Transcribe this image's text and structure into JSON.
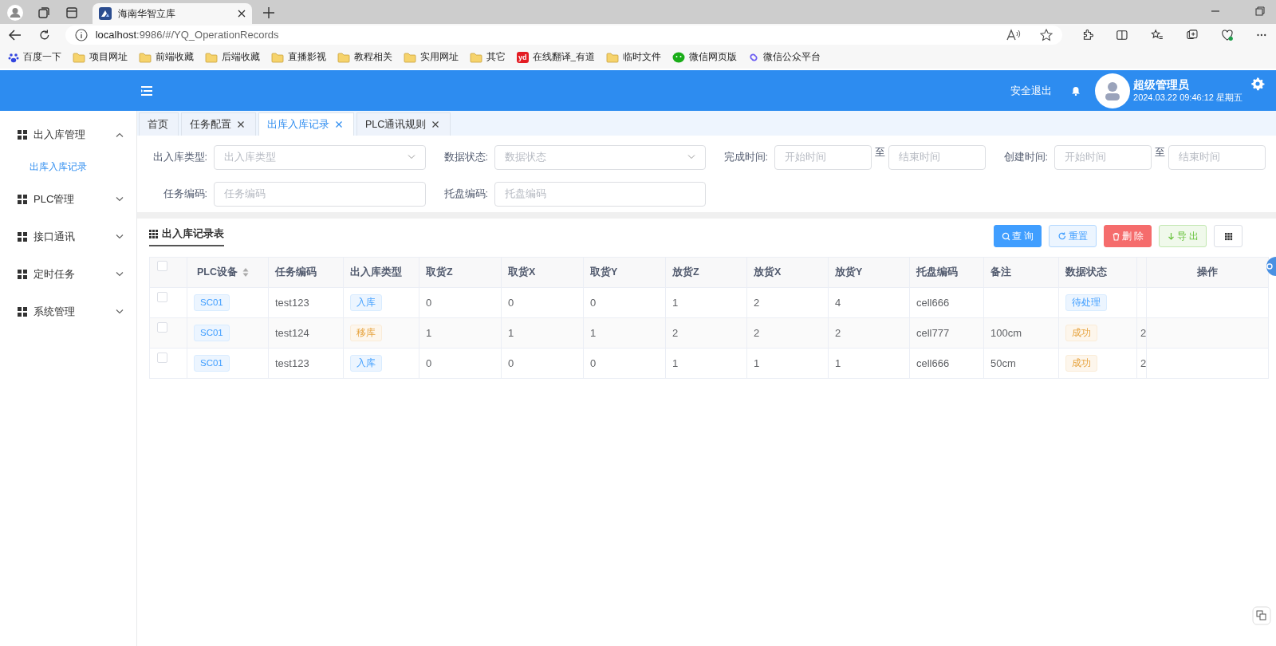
{
  "browser": {
    "tabs": [
      {
        "title": "海南华智立库",
        "selected": true
      }
    ],
    "url": {
      "host": "localhost",
      "path": ":9986/#/YQ_OperationRecords"
    },
    "bookmarks": [
      {
        "kind": "paw",
        "label": "百度一下"
      },
      {
        "kind": "folder",
        "label": "项目网址"
      },
      {
        "kind": "folder",
        "label": "前端收藏"
      },
      {
        "kind": "folder",
        "label": "后端收藏"
      },
      {
        "kind": "folder",
        "label": "直播影视"
      },
      {
        "kind": "folder",
        "label": "教程相关"
      },
      {
        "kind": "folder",
        "label": "实用网址"
      },
      {
        "kind": "folder",
        "label": "其它"
      },
      {
        "kind": "badge",
        "badge": "yd",
        "label": "在线翻译_有道"
      },
      {
        "kind": "folder",
        "label": "临时文件"
      },
      {
        "kind": "chat",
        "label": "微信网页版"
      },
      {
        "kind": "link",
        "label": "微信公众平台"
      }
    ]
  },
  "header": {
    "logout": "安全退出",
    "user": "超级管理员",
    "datetime": "2024.03.22 09:46:12 星期五"
  },
  "sidebar": {
    "items": [
      {
        "label": "出入库管理",
        "expanded": true,
        "children": [
          {
            "label": "出库入库记录",
            "selected": true
          }
        ]
      },
      {
        "label": "PLC管理",
        "expanded": false
      },
      {
        "label": "接口通讯",
        "expanded": false
      },
      {
        "label": "定时任务",
        "expanded": false
      },
      {
        "label": "系统管理",
        "expanded": false
      }
    ]
  },
  "tabs": [
    {
      "label": "首页",
      "closable": false,
      "selected": false
    },
    {
      "label": "任务配置",
      "closable": true,
      "selected": false
    },
    {
      "label": "出库入库记录",
      "closable": true,
      "selected": true
    },
    {
      "label": "PLC通讯规则",
      "closable": true,
      "selected": false
    }
  ],
  "filters": [
    [
      {
        "kind": "select",
        "label": "出入库类型:",
        "placeholder": "出入库类型"
      },
      {
        "kind": "select",
        "label": "数据状态:",
        "placeholder": "数据状态"
      },
      {
        "kind": "range",
        "label": "完成时间:",
        "placeholder": "开始时间",
        "separator": "至",
        "placeholder_end": "结束时间"
      },
      {
        "kind": "range",
        "label": "创建时间:",
        "placeholder": "开始时间",
        "separator": "至",
        "placeholder_end": "结束时间"
      }
    ],
    [
      {
        "kind": "text",
        "label": "任务编码:",
        "placeholder": "任务编码"
      },
      {
        "kind": "text",
        "label": "托盘编码:",
        "placeholder": "托盘编码"
      }
    ]
  ],
  "table": {
    "title": "出入库记录表",
    "buttons": [
      {
        "kind": "search",
        "label": "查 询"
      },
      {
        "kind": "reset",
        "label": "重置"
      },
      {
        "kind": "delete",
        "label": "删 除"
      },
      {
        "kind": "export",
        "label": "导 出"
      },
      {
        "kind": "columns"
      }
    ],
    "columns": [
      {
        "kind": "check",
        "checked": false
      },
      {
        "label": "PLC设备",
        "sortable": true
      },
      {
        "label": "任务编码"
      },
      {
        "label": "出入库类型"
      },
      {
        "label": "取货Z"
      },
      {
        "label": "取货X"
      },
      {
        "label": "取货Y"
      },
      {
        "label": "放货Z"
      },
      {
        "label": "放货X"
      },
      {
        "label": "放货Y"
      },
      {
        "label": "托盘编码"
      },
      {
        "label": "备注"
      },
      {
        "label": "数据状态"
      },
      {
        "kind": "cut"
      },
      {
        "kind": "actions",
        "label": "操作"
      }
    ],
    "rows": [
      {
        "checked": false,
        "device": "SC01",
        "task": "test123",
        "type": {
          "text": "入库",
          "kind": "info"
        },
        "values": [
          "0",
          "0",
          "0",
          "1",
          "2",
          "4"
        ],
        "tray": "cell666",
        "note": "",
        "status": {
          "text": "待处理",
          "kind": "info"
        },
        "column_14": ""
      },
      {
        "checked": false,
        "device": "SC01",
        "task": "test124",
        "type": {
          "text": "移库",
          "kind": "warning"
        },
        "values": [
          "1",
          "1",
          "1",
          "2",
          "2",
          "2"
        ],
        "tray": "cell777",
        "note": "100cm",
        "status": {
          "text": "成功",
          "kind": "warning"
        },
        "column_14": "2"
      },
      {
        "checked": false,
        "device": "SC01",
        "task": "test123",
        "type": {
          "text": "入库",
          "kind": "info"
        },
        "values": [
          "0",
          "0",
          "0",
          "1",
          "1",
          "1"
        ],
        "tray": "cell666",
        "note": "50cm",
        "status": {
          "text": "成功",
          "kind": "warning"
        },
        "column_14": "2"
      }
    ]
  }
}
